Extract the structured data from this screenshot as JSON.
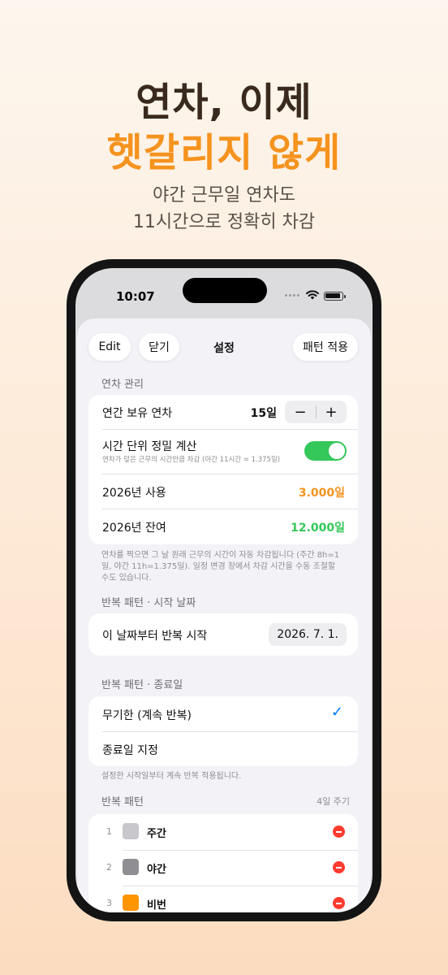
{
  "promo": {
    "title_line1": "연차, 이제",
    "title_line2": "헷갈리지 않게",
    "subtitle_line1": "야간 근무일 연차도",
    "subtitle_line2": "11시간으로 정확히 차감",
    "accent_color": "#f5931e"
  },
  "status_bar": {
    "time": "10:07"
  },
  "sheet": {
    "edit_label": "Edit",
    "close_label": "닫기",
    "title": "설정",
    "apply_label": "패턴 적용"
  },
  "leave": {
    "section_label": "연차 관리",
    "annual_label": "연간 보유 연차",
    "annual_value": "15일",
    "minus": "−",
    "plus": "+",
    "precise_label": "시간 단위 정밀 계산",
    "precise_desc": "연차가 덮은 근무의 시간만큼 차감 (야간 11시간 = 1.375일)",
    "precise_on": true,
    "used_label": "2026년 사용",
    "used_value": "3.000일",
    "used_color": "#f5931e",
    "remain_label": "2026년 잔여",
    "remain_value": "12.000일",
    "remain_color": "#34c759",
    "footnote": "연차를 찍으면 그 날 원래 근무의 시간이 자동 차감됩니다 (주간 8h=1일, 야간 11h=1.375일). 일정 변경 창에서 차감 시간을 수동 조절할 수도 있습니다."
  },
  "start": {
    "section_label": "반복 패턴 · 시작 날짜",
    "row_label": "이 날짜부터 반복 시작",
    "date": "2026. 7. 1."
  },
  "end": {
    "section_label": "반복 패턴 · 종료일",
    "option1": "무기한 (계속 반복)",
    "option2": "종료일 지정",
    "checkmark": "✓",
    "footnote": "설정한 시작일부터 계속 반복 적용됩니다."
  },
  "pattern": {
    "section_label": "반복 패턴",
    "cycle": "4일 주기",
    "items": [
      {
        "num": "1",
        "name": "주간",
        "color": "#c7c7cc"
      },
      {
        "num": "2",
        "name": "야간",
        "color": "#8e8e93"
      },
      {
        "num": "3",
        "name": "비번",
        "color": "#ff9500"
      }
    ]
  }
}
